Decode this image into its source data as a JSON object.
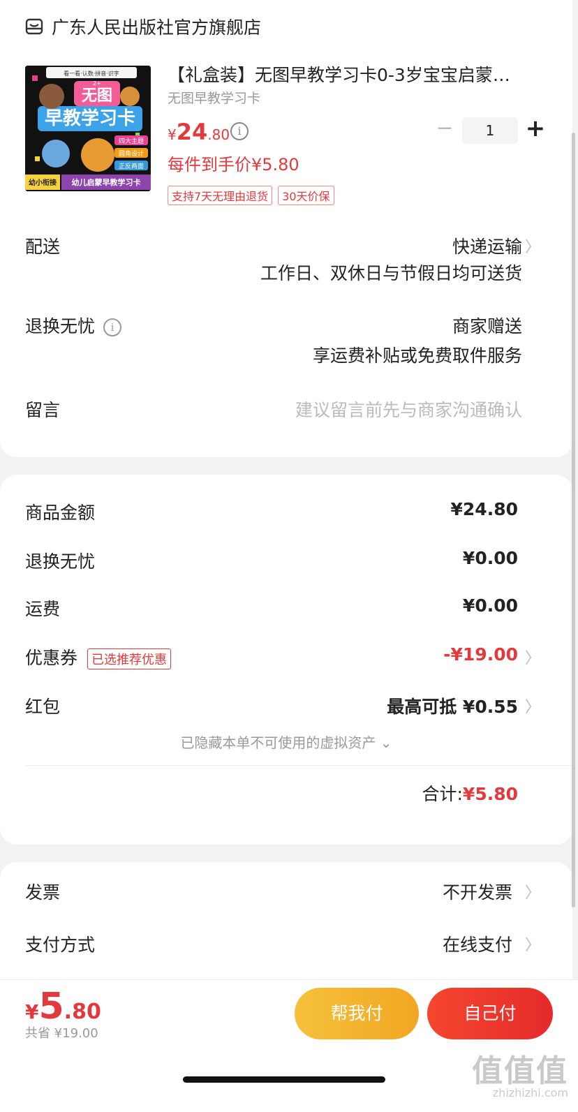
{
  "store": {
    "name": "广东人民出版社官方旗舰店",
    "icon": "store-icon"
  },
  "product": {
    "title": "【礼盒装】无图早教学习卡0-3岁宝宝启蒙…",
    "subtitle": "无图早教学习卡",
    "price_yen": "¥",
    "price_int": "24",
    "price_dec": ".80",
    "quantity": "1",
    "minus": "−",
    "plus": "+",
    "unit_price_label": "每件到手价¥5.80",
    "tags": [
      "支持7天无理由退货",
      "30天价保"
    ],
    "image": {
      "top_banner": "看一看·认数·拼音·识字",
      "title1": "无图",
      "title2": "早教学习卡",
      "badge": "2+",
      "chip1": "四大主题",
      "chip2": "圆角设计",
      "chip3": "正反两面",
      "left_tag": "幼小衔接",
      "bottom_text": "幼儿启蒙早教学习卡"
    }
  },
  "delivery": {
    "label": "配送",
    "method": "快递运输",
    "note": "工作日、双休日与节假日均可送货"
  },
  "returns": {
    "label": "退换无忧",
    "value": "商家赠送",
    "note": "享运费补贴或免费取件服务"
  },
  "message": {
    "label": "留言",
    "placeholder": "建议留言前先与商家沟通确认"
  },
  "summary": {
    "goods_label": "商品金额",
    "goods_value": "¥24.80",
    "returns_label": "退换无忧",
    "returns_value": "¥0.00",
    "shipping_label": "运费",
    "shipping_value": "¥0.00",
    "coupon_label": "优惠券",
    "coupon_tag": "已选推荐优惠",
    "coupon_value": "-¥19.00",
    "redpack_label": "红包",
    "redpack_value": "最高可抵 ¥0.55",
    "hidden_note": "已隐藏本单不可使用的虚拟资产 ⌄",
    "total_label": "合计:",
    "total_value": "¥5.80"
  },
  "invoice": {
    "label": "发票",
    "value": "不开发票"
  },
  "payment": {
    "label": "支付方式",
    "value": "在线支付"
  },
  "footer": {
    "total_yen": "¥",
    "total_int": "5",
    "total_dec": ".80",
    "saved": "共省 ¥19.00",
    "help_pay": "帮我付",
    "self_pay": "自己付"
  },
  "watermark": {
    "text": "值值值",
    "url": "zhizhizhi.com"
  },
  "colors": {
    "accent": "#e4393c",
    "help_btn": "#f2a623",
    "self_btn": "#e52a2a"
  }
}
